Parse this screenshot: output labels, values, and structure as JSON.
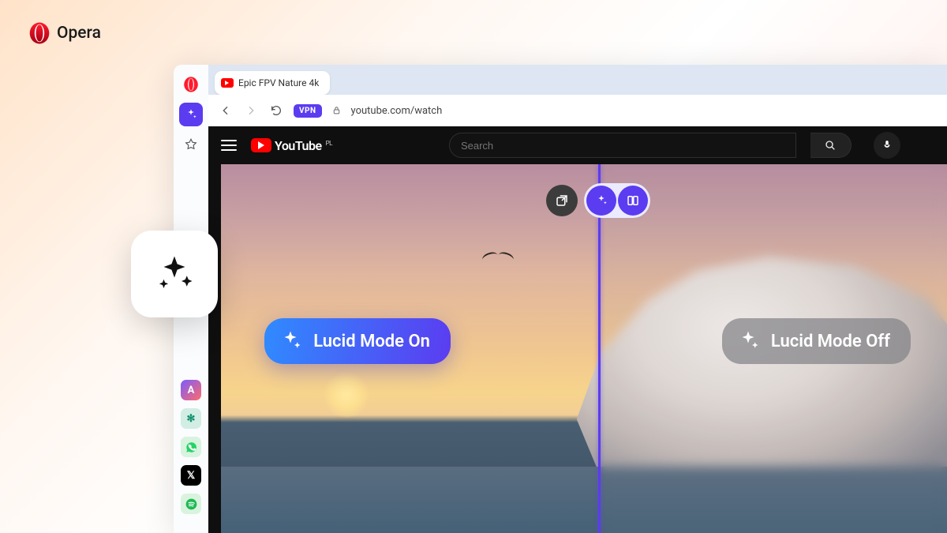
{
  "brand": {
    "name": "Opera"
  },
  "tab": {
    "title": "Epic FPV Nature 4k"
  },
  "addressbar": {
    "vpn_label": "VPN",
    "url": "youtube.com/watch"
  },
  "youtube": {
    "logo_text": "YouTube",
    "region": "PL",
    "search_placeholder": "Search"
  },
  "lucid": {
    "on_label": "Lucid Mode On",
    "off_label": "Lucid Mode Off"
  },
  "sidebar_apps": [
    "aria",
    "chatgpt",
    "whatsapp",
    "x",
    "spotify"
  ]
}
